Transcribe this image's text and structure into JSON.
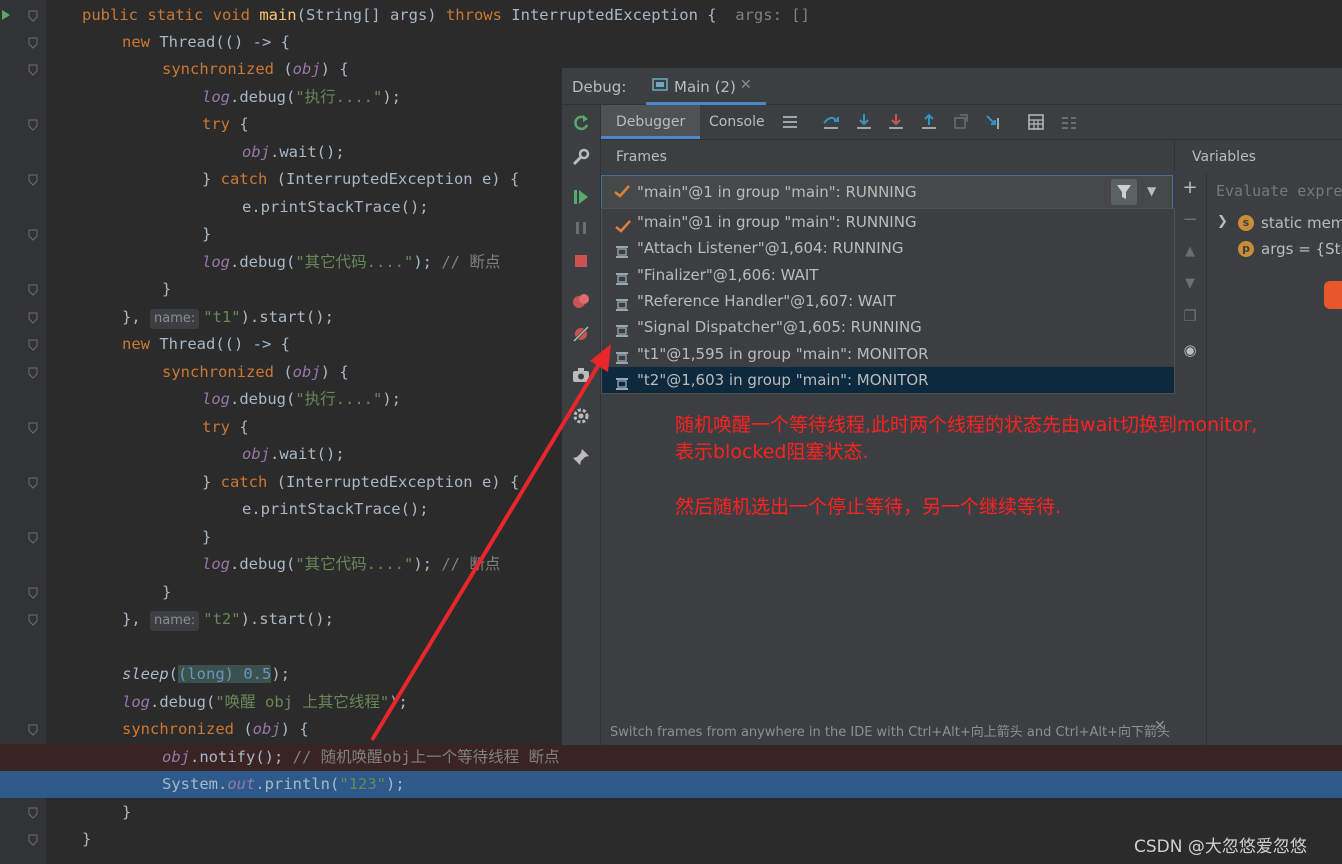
{
  "editor": {
    "lines": [
      {
        "code_parts": [
          {
            "t": "public static void ",
            "c": "k"
          },
          {
            "t": "main",
            "c": "m"
          },
          {
            "t": "(String[] args) ",
            "c": "p"
          },
          {
            "t": "throws ",
            "c": "k"
          },
          {
            "t": "InterruptedException {  ",
            "c": "p"
          },
          {
            "t": "args: []",
            "c": "c"
          }
        ]
      },
      {
        "code_parts": [
          {
            "t": "new ",
            "c": "k"
          },
          {
            "t": "Thread(() -> {",
            "c": "p"
          }
        ]
      },
      {
        "code_parts": [
          {
            "t": "synchronized ",
            "c": "k"
          },
          {
            "t": "(",
            "c": "p"
          },
          {
            "t": "obj",
            "c": "f"
          },
          {
            "t": ") {",
            "c": "p"
          }
        ]
      },
      {
        "code_parts": [
          {
            "t": "log",
            "c": "f"
          },
          {
            "t": ".debug(",
            "c": "p"
          },
          {
            "t": "\"执行....\"",
            "c": "s"
          },
          {
            "t": ");",
            "c": "p"
          }
        ]
      },
      {
        "code_parts": [
          {
            "t": "try ",
            "c": "k"
          },
          {
            "t": "{",
            "c": "p"
          }
        ]
      },
      {
        "code_parts": [
          {
            "t": "obj",
            "c": "f"
          },
          {
            "t": ".wait();",
            "c": "p"
          }
        ]
      },
      {
        "code_parts": [
          {
            "t": "} ",
            "c": "p"
          },
          {
            "t": "catch ",
            "c": "k"
          },
          {
            "t": "(InterruptedException e) {",
            "c": "p"
          }
        ]
      },
      {
        "code_parts": [
          {
            "t": "e.printStackTrace();",
            "c": "p"
          }
        ]
      },
      {
        "code_parts": [
          {
            "t": "}",
            "c": "p"
          }
        ]
      },
      {
        "code_parts": [
          {
            "t": "log",
            "c": "f"
          },
          {
            "t": ".debug(",
            "c": "p"
          },
          {
            "t": "\"其它代码....\"",
            "c": "s"
          },
          {
            "t": "); ",
            "c": "p"
          },
          {
            "t": "// 断点",
            "c": "c"
          }
        ]
      },
      {
        "code_parts": [
          {
            "t": "}",
            "c": "p"
          }
        ]
      },
      {
        "code_parts": [
          {
            "t": "}, ",
            "c": "p"
          },
          {
            "t": "name:",
            "c": "hint"
          },
          {
            "t": "\"t1\"",
            "c": "s"
          },
          {
            "t": ").start();",
            "c": "p"
          }
        ]
      },
      {
        "code_parts": [
          {
            "t": "new ",
            "c": "k"
          },
          {
            "t": "Thread(() -> {",
            "c": "p"
          }
        ]
      },
      {
        "code_parts": [
          {
            "t": "synchronized ",
            "c": "k"
          },
          {
            "t": "(",
            "c": "p"
          },
          {
            "t": "obj",
            "c": "f"
          },
          {
            "t": ") {",
            "c": "p"
          }
        ]
      },
      {
        "code_parts": [
          {
            "t": "log",
            "c": "f"
          },
          {
            "t": ".debug(",
            "c": "p"
          },
          {
            "t": "\"执行....\"",
            "c": "s"
          },
          {
            "t": ");",
            "c": "p"
          }
        ]
      },
      {
        "code_parts": [
          {
            "t": "try ",
            "c": "k"
          },
          {
            "t": "{",
            "c": "p"
          }
        ]
      },
      {
        "code_parts": [
          {
            "t": "obj",
            "c": "f"
          },
          {
            "t": ".wait();",
            "c": "p"
          }
        ]
      },
      {
        "code_parts": [
          {
            "t": "} ",
            "c": "p"
          },
          {
            "t": "catch ",
            "c": "k"
          },
          {
            "t": "(InterruptedException e) {",
            "c": "p"
          }
        ]
      },
      {
        "code_parts": [
          {
            "t": "e.printStackTrace();",
            "c": "p"
          }
        ]
      },
      {
        "code_parts": [
          {
            "t": "}",
            "c": "p"
          }
        ]
      },
      {
        "code_parts": [
          {
            "t": "log",
            "c": "f"
          },
          {
            "t": ".debug(",
            "c": "p"
          },
          {
            "t": "\"其它代码....\"",
            "c": "s"
          },
          {
            "t": "); ",
            "c": "p"
          },
          {
            "t": "// 断点",
            "c": "c"
          }
        ]
      },
      {
        "code_parts": [
          {
            "t": "}",
            "c": "p"
          }
        ]
      },
      {
        "code_parts": [
          {
            "t": "}, ",
            "c": "p"
          },
          {
            "t": "name:",
            "c": "hint"
          },
          {
            "t": "\"t2\"",
            "c": "s"
          },
          {
            "t": ").start();",
            "c": "p"
          }
        ]
      },
      {
        "code_parts": []
      },
      {
        "code_parts": [
          {
            "t": "sleep",
            "c": "fi"
          },
          {
            "t": "(",
            "c": "p"
          },
          {
            "t": "(long) 0.5",
            "c": "ph"
          },
          {
            "t": ");",
            "c": "p"
          }
        ]
      },
      {
        "code_parts": [
          {
            "t": "log",
            "c": "f"
          },
          {
            "t": ".debug(",
            "c": "p"
          },
          {
            "t": "\"唤醒 obj 上其它线程\"",
            "c": "s"
          },
          {
            "t": ");",
            "c": "p"
          }
        ]
      },
      {
        "code_parts": [
          {
            "t": "synchronized ",
            "c": "k"
          },
          {
            "t": "(",
            "c": "p"
          },
          {
            "t": "obj",
            "c": "f"
          },
          {
            "t": ") {",
            "c": "p"
          }
        ]
      },
      {
        "code_parts": [
          {
            "t": "obj",
            "c": "f"
          },
          {
            "t": ".notify(); ",
            "c": "p"
          },
          {
            "t": "// 随机唤醒obj上一个等待线程 断点",
            "c": "c"
          }
        ]
      },
      {
        "code_parts": [
          {
            "t": "System.",
            "c": "p"
          },
          {
            "t": "out",
            "c": "f"
          },
          {
            "t": ".println(",
            "c": "p"
          },
          {
            "t": "\"123\"",
            "c": "s"
          },
          {
            "t": ");",
            "c": "p"
          }
        ]
      },
      {
        "code_parts": [
          {
            "t": "}",
            "c": "p"
          }
        ]
      },
      {
        "code_parts": [
          {
            "t": "}",
            "c": "p"
          }
        ]
      }
    ]
  },
  "debug": {
    "title": "Debug:",
    "session_tab": "Main (2)",
    "tabs": [
      "Debugger",
      "Console"
    ],
    "frames_label": "Frames",
    "variables_label": "Variables",
    "selected_thread": "\"main\"@1 in group \"main\": RUNNING",
    "threads": [
      {
        "label": "\"main\"@1 in group \"main\": RUNNING",
        "icon": "check-icon"
      },
      {
        "label": "\"Attach Listener\"@1,604: RUNNING",
        "icon": "thread-icon"
      },
      {
        "label": "\"Finalizer\"@1,606: WAIT",
        "icon": "thread-icon"
      },
      {
        "label": "\"Reference Handler\"@1,607: WAIT",
        "icon": "thread-icon"
      },
      {
        "label": "\"Signal Dispatcher\"@1,605: RUNNING",
        "icon": "thread-icon"
      },
      {
        "label": "\"t1\"@1,595 in group \"main\": MONITOR",
        "icon": "thread-icon"
      },
      {
        "label": "\"t2\"@1,603 in group \"main\": MONITOR",
        "icon": "thread-icon"
      }
    ],
    "eval_placeholder": "Evaluate expre",
    "variables": [
      {
        "badge": "s",
        "label": "static memb"
      },
      {
        "badge": "p",
        "label": "args = {Stri"
      }
    ],
    "annotation_line1": "随机唤醒一个等待线程,此时两个线程的状态先由wait切换到monitor,",
    "annotation_line2": "表示blocked阻塞状态.",
    "annotation_line3": "然后随机选出一个停止等待，另一个继续等待.",
    "status_tip": "Switch frames from anywhere in the IDE with Ctrl+Alt+向上箭头 and Ctrl+Alt+向下箭头"
  },
  "watermark": "CSDN @大忽悠爱忽悠",
  "colors": {
    "accent": "#4a88c7",
    "annotation": "#ff2020",
    "arrow": "#e8262b"
  }
}
